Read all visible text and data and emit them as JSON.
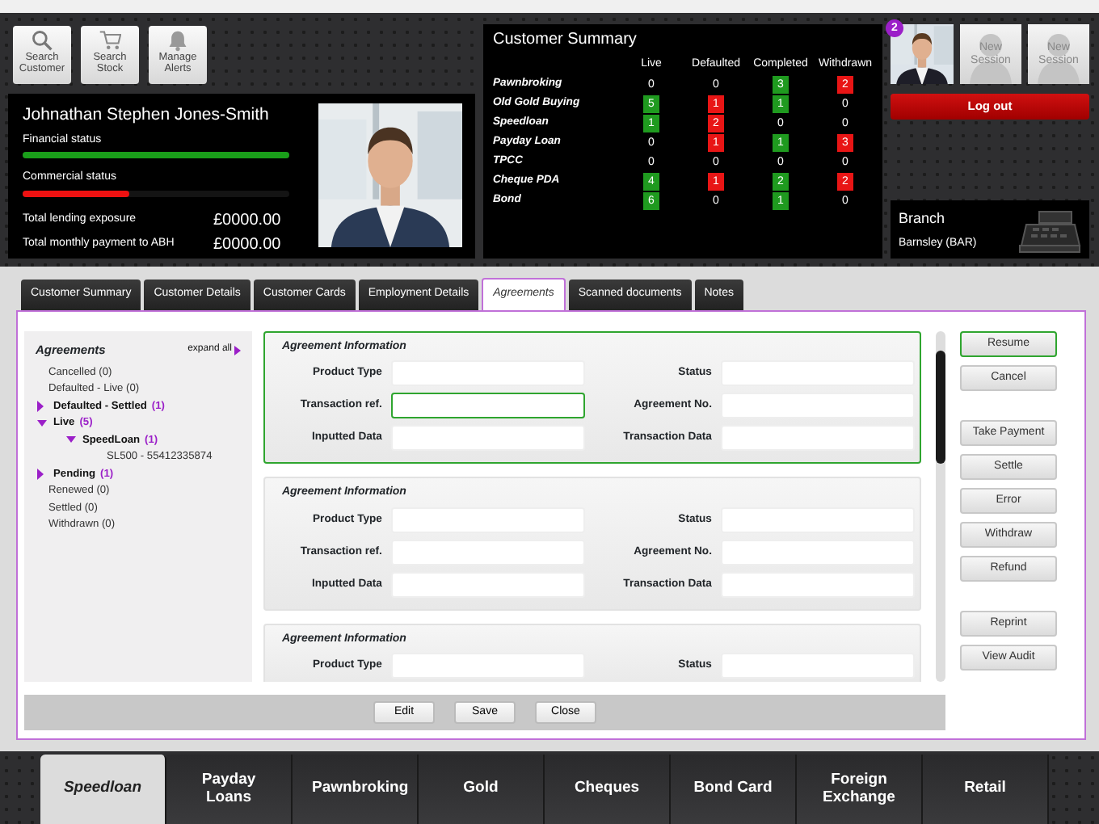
{
  "toolbar": [
    {
      "kind": "search",
      "label": "Search Customer"
    },
    {
      "kind": "cart",
      "label": "Search Stock"
    },
    {
      "kind": "bell",
      "label": "Manage Alerts"
    }
  ],
  "customer": {
    "name": "Johnathan Stephen Jones-Smith",
    "statuses": [
      {
        "label": "Financial status",
        "level": 1,
        "color": "#1a9e1a"
      },
      {
        "label": "Commercial status",
        "level": 0.4,
        "color": "#ee1111"
      }
    ],
    "totals": [
      {
        "label": "Total lending exposure",
        "value": "£0000.00"
      },
      {
        "label": "Total monthly payment to ABH",
        "value": "£0000.00"
      }
    ]
  },
  "summary": {
    "title": "Customer Summary",
    "columns": [
      "Live",
      "Defaulted",
      "Completed",
      "Withdrawn"
    ],
    "rows": [
      {
        "product": "Pawnbroking",
        "cells": [
          {
            "value": "0"
          },
          {
            "value": "0"
          },
          {
            "value": "3",
            "color": "#1f9a1f"
          },
          {
            "value": "2",
            "color": "#e81515"
          }
        ]
      },
      {
        "product": "Old Gold Buying",
        "cells": [
          {
            "value": "5",
            "color": "#1f9a1f"
          },
          {
            "value": "1",
            "color": "#e81515"
          },
          {
            "value": "1",
            "color": "#1f9a1f"
          },
          {
            "value": "0"
          }
        ]
      },
      {
        "product": "Speedloan",
        "cells": [
          {
            "value": "1",
            "color": "#1f9a1f"
          },
          {
            "value": "2",
            "color": "#e81515"
          },
          {
            "value": "0"
          },
          {
            "value": "0"
          }
        ]
      },
      {
        "product": "Payday Loan",
        "cells": [
          {
            "value": "0"
          },
          {
            "value": "1",
            "color": "#e81515"
          },
          {
            "value": "1",
            "color": "#1f9a1f"
          },
          {
            "value": "3",
            "color": "#e81515"
          }
        ]
      },
      {
        "product": "TPCC",
        "cells": [
          {
            "value": "0"
          },
          {
            "value": "0"
          },
          {
            "value": "0"
          },
          {
            "value": "0"
          }
        ]
      },
      {
        "product": "Cheque PDA",
        "cells": [
          {
            "value": "4",
            "color": "#1f9a1f"
          },
          {
            "value": "1",
            "color": "#e81515"
          },
          {
            "value": "2",
            "color": "#1f9a1f"
          },
          {
            "value": "2",
            "color": "#e81515"
          }
        ]
      },
      {
        "product": "Bond",
        "cells": [
          {
            "value": "6",
            "color": "#1f9a1f"
          },
          {
            "value": "0"
          },
          {
            "value": "1",
            "color": "#1f9a1f"
          },
          {
            "value": "0"
          }
        ]
      }
    ]
  },
  "sessions": [
    {
      "kind": "user",
      "badge": "2"
    },
    {
      "kind": "new",
      "label": "New Session"
    },
    {
      "kind": "new",
      "label": "New Session"
    }
  ],
  "logout": "Log out",
  "branch": {
    "title": "Branch",
    "value": "Barnsley (BAR)"
  },
  "tabs": [
    {
      "label": "Customer Summary",
      "selected": false
    },
    {
      "label": "Customer Details",
      "selected": false
    },
    {
      "label": "Customer Cards",
      "selected": false
    },
    {
      "label": "Employment Details",
      "selected": false
    },
    {
      "label": "Agreements",
      "selected": true
    },
    {
      "label": "Scanned documents",
      "selected": false
    },
    {
      "label": "Notes",
      "selected": false
    }
  ],
  "tree": {
    "title": "Agreements",
    "expand_all": "expand all",
    "items": [
      {
        "label": "Cancelled (0)"
      },
      {
        "label": "Defaulted - Live (0)"
      },
      {
        "label": "Defaulted - Settled",
        "count": "(1)",
        "expanded": false
      },
      {
        "label": "Live",
        "count": "(5)",
        "expanded": true,
        "children": [
          {
            "label": "SpeedLoan",
            "count": "(1)",
            "expanded": true,
            "children": [
              {
                "label": "SL500 - 55412335874"
              }
            ]
          }
        ]
      },
      {
        "label": "Pending",
        "count": "(1)",
        "expanded": false
      },
      {
        "label": "Renewed (0)"
      },
      {
        "label": "Settled (0)"
      },
      {
        "label": "Withdrawn (0)"
      }
    ]
  },
  "cards": [
    {
      "title": "Agreement Information",
      "selected": true,
      "fields": [
        {
          "label": "Product Type",
          "focused": false
        },
        {
          "label": "Status",
          "focused": false
        },
        {
          "label": "Transaction ref.",
          "focused": true
        },
        {
          "label": "Agreement No.",
          "focused": false
        },
        {
          "label": "Inputted Data",
          "focused": false
        },
        {
          "label": "Transaction Data",
          "focused": false
        }
      ]
    },
    {
      "title": "Agreement Information",
      "selected": false,
      "fields": [
        {
          "label": "Product Type",
          "focused": false
        },
        {
          "label": "Status",
          "focused": false
        },
        {
          "label": "Transaction ref.",
          "focused": false
        },
        {
          "label": "Agreement No.",
          "focused": false
        },
        {
          "label": "Inputted Data",
          "focused": false
        },
        {
          "label": "Transaction Data",
          "focused": false
        }
      ]
    },
    {
      "title": "Agreement Information",
      "selected": false,
      "fields": [
        {
          "label": "Product Type",
          "focused": false
        },
        {
          "label": "Status",
          "focused": false
        }
      ]
    }
  ],
  "action_groups": [
    [
      {
        "label": "Resume",
        "highlighted": true
      },
      {
        "label": "Cancel",
        "highlighted": false
      }
    ],
    [
      {
        "label": "Take Payment",
        "highlighted": false
      },
      {
        "label": "Settle",
        "highlighted": false
      },
      {
        "label": "Error",
        "highlighted": false
      },
      {
        "label": "Withdraw",
        "highlighted": false
      },
      {
        "label": "Refund",
        "highlighted": false
      }
    ],
    [
      {
        "label": "Reprint",
        "highlighted": false
      },
      {
        "label": "View Audit",
        "highlighted": false
      }
    ]
  ],
  "footer_buttons": [
    "Edit",
    "Save",
    "Close"
  ],
  "products": [
    {
      "label": "Speedloan",
      "selected": true
    },
    {
      "label": "Payday Loans",
      "selected": false
    },
    {
      "label": "Pawnbroking",
      "selected": false
    },
    {
      "label": "Gold",
      "selected": false
    },
    {
      "label": "Cheques",
      "selected": false
    },
    {
      "label": "Bond Card",
      "selected": false
    },
    {
      "label": "Foreign Exchange",
      "selected": false
    },
    {
      "label": "Retail",
      "selected": false
    }
  ]
}
